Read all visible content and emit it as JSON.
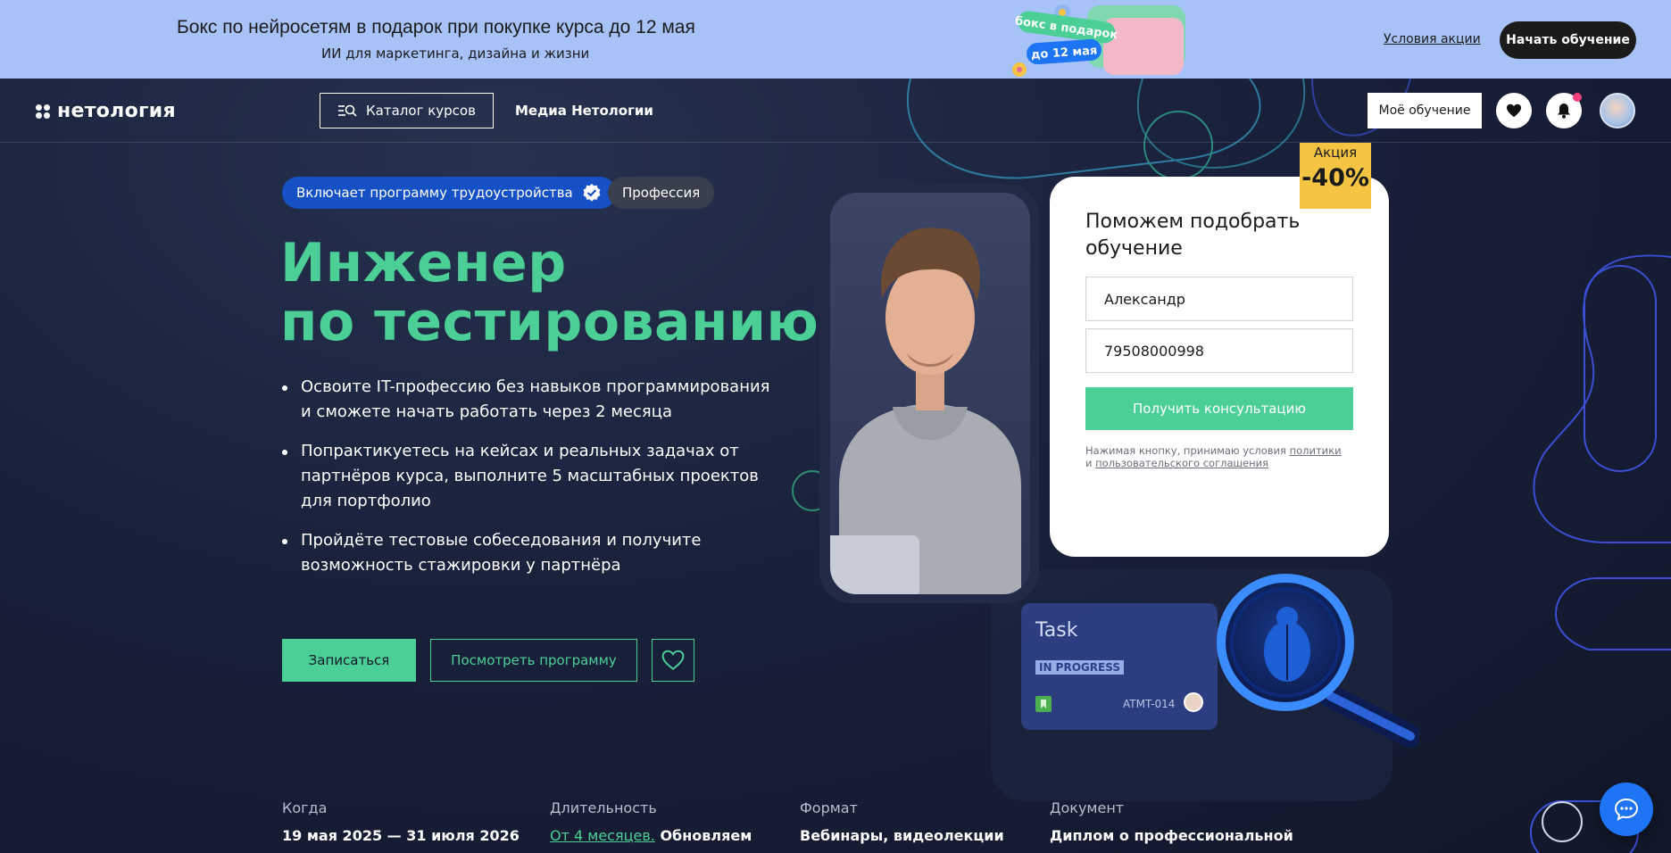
{
  "promo": {
    "title": "Бокс по нейросетям в подарок при покупке курса до 12 мая",
    "subtitle": "ИИ для маркетинга, дизайна и жизни",
    "sticker_gift": "бокс в подарок",
    "sticker_date": "до 12 мая",
    "terms_link": "Условия акции",
    "cta": "Начать обучение"
  },
  "header": {
    "logo": "нетология",
    "catalog": "Каталог курсов",
    "media": "Медиа Нетологии",
    "my_learning": "Моё обучение",
    "icons": [
      "heart-icon",
      "bell-icon",
      "avatar"
    ]
  },
  "hero": {
    "badge_employment": "Включает программу трудоустройства",
    "badge_type": "Профессия",
    "title_line1": "Инженер",
    "title_line2": "по тестированию",
    "bullets": [
      "Освоите IT-профессию без навыков программирования и сможете начать работать через 2 месяца",
      "Попрактикуетесь на кейсах и реальных задачах от партнёров курса, выполните 5 масштабных проектов для портфолио",
      "Пройдёте тестовые собеседования и получите возможность стажировки у партнёра"
    ],
    "btn_enroll": "Записаться",
    "btn_program": "Посмотреть программу"
  },
  "form": {
    "title": "Поможем подобрать обучение",
    "name_value": "Александр",
    "phone_value": "79508000998",
    "submit": "Получить консультацию",
    "legal_text": "Нажимая кнопку, принимаю условия",
    "legal_policy": "политики",
    "legal_and": "и",
    "legal_agreement": "пользовательского соглашения"
  },
  "sale": {
    "label": "Акция",
    "discount": "-40%"
  },
  "task_card": {
    "title": "Task",
    "status": "IN PROGRESS",
    "id": "ATMT-014"
  },
  "info": {
    "when_label": "Когда",
    "when_value": "19 мая 2025 — 31 июля 2026",
    "duration_label": "Длительность",
    "duration_link": "От 4 месяцев.",
    "duration_rest": "Обновляем",
    "format_label": "Формат",
    "format_value": "Вебинары, видеолекции",
    "doc_label": "Документ",
    "doc_value": "Диплом о профессиональной"
  },
  "colors": {
    "accent": "#4ccf96",
    "brand_blue": "#1550c4",
    "promo_bg": "#a6c2f7",
    "sale": "#f6c443"
  }
}
